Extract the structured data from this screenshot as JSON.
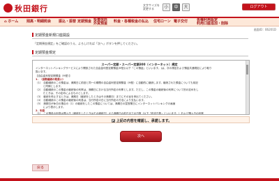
{
  "header": {
    "bank_name": "秋田銀行",
    "font_size_label": "文字サイズを変更する",
    "font_sizes": [
      "小",
      "中",
      "大"
    ],
    "active_font_size": "中",
    "logout_label": "ログアウト"
  },
  "nav": {
    "items": [
      {
        "label": "ホーム"
      },
      {
        "label": "残高・明細照会"
      },
      {
        "label": "振込・振替"
      },
      {
        "label": "定期預金"
      },
      {
        "label": "投資信託\n外貨預金"
      },
      {
        "label": "料金・各種税金の払込"
      },
      {
        "label": "住宅ローン"
      },
      {
        "label": "電子交付"
      },
      {
        "label": "各種利用設定\n利用口座追加・削除"
      }
    ]
  },
  "date": "画面ID：BS201D",
  "page": {
    "title": "定期預金新規口座開設",
    "instruction": "「定期預金規定」をご確認のうえ、よろしければ「次へ」ボタンを押してください。",
    "section_title": "定期預金規定"
  },
  "terms": {
    "heading": "スーパー定期・スーパー定期300（インターネット）規定",
    "lines": [
      "インターネットバンキングサービスにより開設された自由金利型定期預金(M型)(以下「この預金」といいます。)は、次の規定および預金共通規定により取り",
      "扱います。",
      "【自由金利型定期預金（M型）】",
      "1．（自動継続の取扱い）",
      "（1）　自動継続のこの預金は、満期日に前回と同一の期間の自由金利型定期預金（M型）に自動的に継続します。継続された預金についても前記",
      "　　　と同様とします。",
      "（2）　自動継続のこの預金の継続後の利率は、満期日における当行所定の利率とします。ただし、この預金の継続後の利率について別の定めをし",
      "　　　たときは、その定めによるものとします。",
      "（3）　継続を停止するときは、満期日（継続をしたときはその満期日）までにその旨を申出てください。",
      "（4）　自動継続のこの預金の継続後の利息は、当行所定の日に当行所定の方法により支払います。",
      "（5）　満期日が休日の場合の（1）の継続をしたこの預金については、満期日の翌営業日にインターネットバンキングの画面",
      "　　　により表示します。",
      "2．利息",
      "（1）　この預金の利息は預入日（継続をしたときはその継続日）から満期日の前日までの日数（以下「約定日数」といいます。）および預入日の利率"
    ]
  },
  "agree_label": "上記の内容を確認し、承諾します。",
  "next_label": "次へ",
  "back_label": "戻る",
  "colors": {
    "brand": "#c4121b",
    "nav_bg": "#fde8d9"
  }
}
